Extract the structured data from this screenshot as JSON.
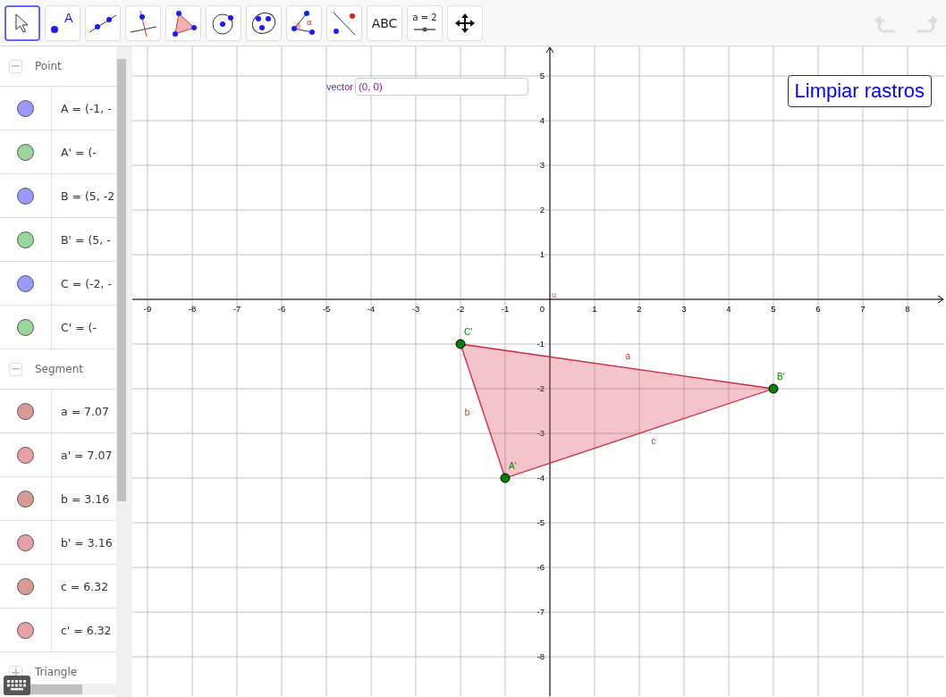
{
  "toolbar": {
    "tools": [
      {
        "kind": "move",
        "selected": true
      },
      {
        "kind": "point",
        "selected": false,
        "label": "A"
      },
      {
        "kind": "line",
        "selected": false
      },
      {
        "kind": "perpendicular",
        "selected": false
      },
      {
        "kind": "polygon",
        "selected": false
      },
      {
        "kind": "circle",
        "selected": false
      },
      {
        "kind": "conic",
        "selected": false
      },
      {
        "kind": "angle",
        "selected": false,
        "label": "α"
      },
      {
        "kind": "reflect",
        "selected": false
      },
      {
        "kind": "text",
        "selected": false,
        "label": "ABC"
      },
      {
        "kind": "slider",
        "selected": false,
        "label": "a = 2"
      },
      {
        "kind": "pan",
        "selected": false
      }
    ],
    "undo": {
      "disabled": true
    },
    "redo": {
      "disabled": true
    }
  },
  "algebra": {
    "groups": [
      {
        "title": "Point",
        "expanded": true,
        "items": [
          {
            "text": "A = (-1, -",
            "color": "#9999ff"
          },
          {
            "text": "A' = (-",
            "color": "#99d699"
          },
          {
            "text": "B = (5, -2",
            "color": "#9999ff"
          },
          {
            "text": "B' = (5, -",
            "color": "#99d699"
          },
          {
            "text": "C = (-2, -",
            "color": "#9999ff"
          },
          {
            "text": "C' = (-",
            "color": "#99d699"
          }
        ]
      },
      {
        "title": "Segment",
        "expanded": true,
        "items": [
          {
            "text": "a = 7.07",
            "color": "#d99a94"
          },
          {
            "text": "a' = 7.07",
            "color": "#e8a0a8"
          },
          {
            "text": "b = 3.16",
            "color": "#d99a94"
          },
          {
            "text": "b' = 3.16",
            "color": "#e8a0a8"
          },
          {
            "text": "c = 6.32",
            "color": "#d99a94"
          },
          {
            "text": "c' = 6.32",
            "color": "#e8a0a8"
          }
        ]
      },
      {
        "title": "Triangle",
        "expanded": false
      }
    ]
  },
  "graphics": {
    "input": {
      "label": "vector",
      "value": "(0, 0)"
    },
    "button": "Limpiar rastros",
    "vector_label": "u",
    "origin_label": "0",
    "point_labels": [
      "C'",
      "B'",
      "A'"
    ],
    "segment_labels": [
      "a",
      "c",
      "b"
    ],
    "chart_data": {
      "type": "scatter",
      "grid": true,
      "xlim": [
        -9.34,
        8.82
      ],
      "ylim": [
        -8.88,
        5.66
      ],
      "xticks": [
        -9,
        -8,
        -7,
        -6,
        -5,
        -4,
        -3,
        -2,
        -1,
        1,
        2,
        3,
        4,
        5,
        6,
        7,
        8
      ],
      "yticks": [
        5,
        4,
        3,
        2,
        1,
        -1,
        -2,
        -3,
        -4,
        -5,
        -6,
        -7,
        -8
      ],
      "x": [
        -2,
        5,
        -1
      ],
      "series": [
        {
          "color": "#008000",
          "values": [
            -1,
            -2,
            -4
          ]
        }
      ]
    }
  }
}
